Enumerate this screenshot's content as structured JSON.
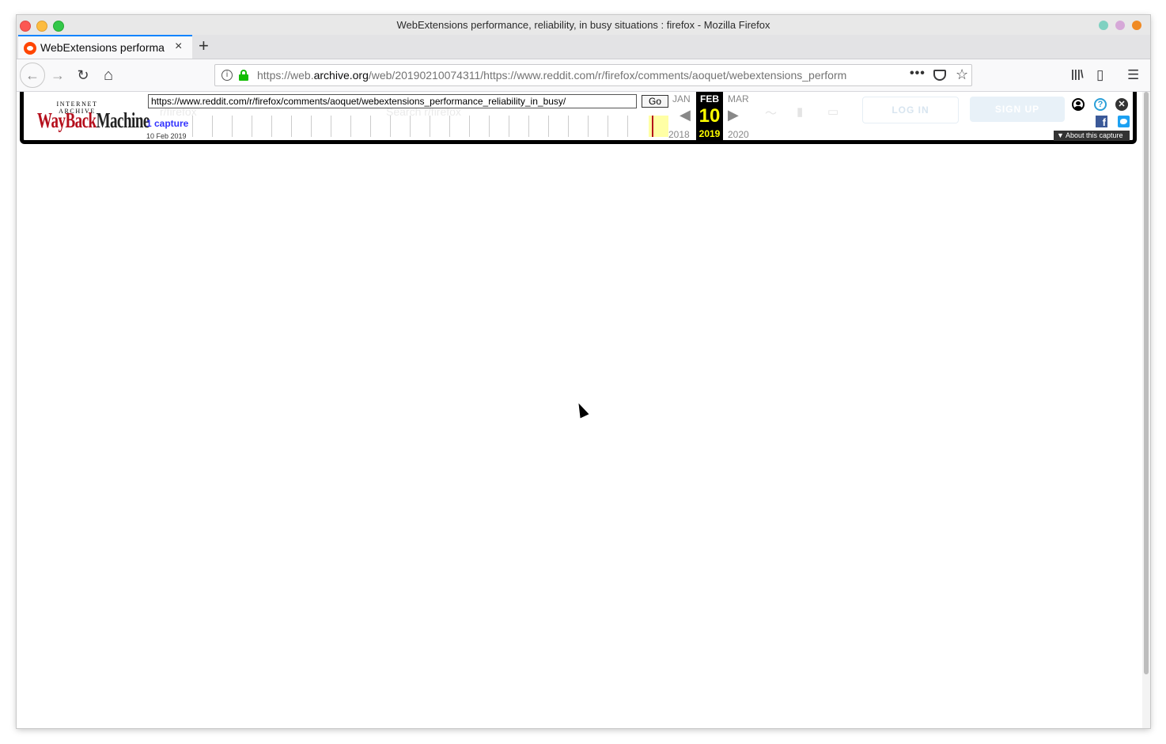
{
  "window": {
    "title": "WebExtensions performance, reliability, in busy situations : firefox - Mozilla Firefox"
  },
  "tab": {
    "title": "WebExtensions performa",
    "close": "×",
    "new_tab": "+"
  },
  "nav": {
    "back": "←",
    "forward": "→",
    "reload": "↻",
    "home": "⌂"
  },
  "urlbar": {
    "prefix": "https://web.",
    "domain": "archive.org",
    "suffix": "/web/20190210074311/https://www.reddit.com/r/firefox/comments/aoquet/webextensions_perform",
    "info": "i",
    "page_actions": "•••",
    "bookmark": "☆"
  },
  "toolbar": {
    "library": "|||\\",
    "sidebar": "▯",
    "menu": "☰"
  },
  "wayback": {
    "logo_top": "INTERNET ARCHIVE",
    "logo_main_red": "WayBack",
    "logo_main_dark": "Machine",
    "url_value": "https://www.reddit.com/r/firefox/comments/aoquet/webextensions_performance_reliability_in_busy/",
    "go_label": "Go",
    "capture_count": "1 capture",
    "capture_date": "10 Feb 2019",
    "prev_month": "JAN",
    "prev_year": "2018",
    "cur_month": "FEB",
    "cur_day": "10",
    "cur_year": "2019",
    "next_month": "MAR",
    "next_year": "2020",
    "prev_arrow": "◀",
    "next_arrow": "▶",
    "about_label": "About this capture",
    "about_caret": "▼",
    "help": "?",
    "close": "✕",
    "facebook": "f"
  },
  "underlying_page": {
    "subreddit": "r/firefox",
    "search_placeholder": "Search r/firefox",
    "login": "LOG IN",
    "signup": "SIGN UP"
  },
  "colors": {
    "firefox_accent": "#0a84ff",
    "wayback_red": "#b50f1c",
    "highlight_yellow": "#ffff00",
    "capture_blue": "#3333ff",
    "lock_green": "#12bc00"
  }
}
